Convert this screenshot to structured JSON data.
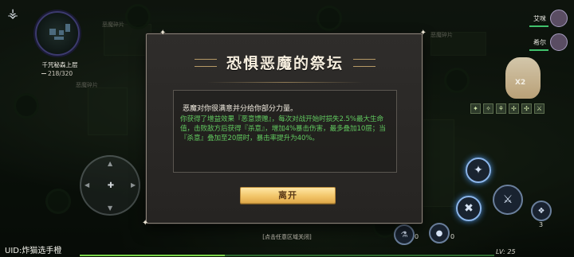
{
  "hud": {
    "map_name": "千咒秘森上层",
    "map_progress": "218/320",
    "scene_labels": [
      "恶魔碎片",
      "恶魔碎片",
      "恶魔碎片"
    ],
    "uid": "UID:炸猫选手橙",
    "level": "LV: 25",
    "exp_fraction": 0.35
  },
  "party": [
    {
      "name": "艾咪"
    },
    {
      "name": "希尔"
    }
  ],
  "hero": {
    "multiplier": "X2"
  },
  "skills": {
    "counts": [
      "0",
      "0",
      "3"
    ]
  },
  "dialog": {
    "title": "恐惧恶魔的祭坛",
    "line1": "恶魔对你很满意并分给你部分力量。",
    "effect": "你获得了增益效果『恶意馈赠』，每次对战开始时损失2.5%最大生命值，击败敌方后获得『杀意』，增加4%暴击伤害，最多叠加10层；当『杀意』叠加至20层时，暴击率提升为40%。",
    "leave_button": "离开",
    "hint": "[点击任意区域关闭]"
  },
  "colors": {
    "effect_text": "#61c85f",
    "button_gold": "#f2c66a",
    "dialog_bg": "#2f2d2b"
  },
  "icons": [
    "wing-icon",
    "minimap",
    "dpad-icon",
    "sword-skill-icon",
    "lightning-skill-icon",
    "blade-skill-icon",
    "potion-icon"
  ]
}
